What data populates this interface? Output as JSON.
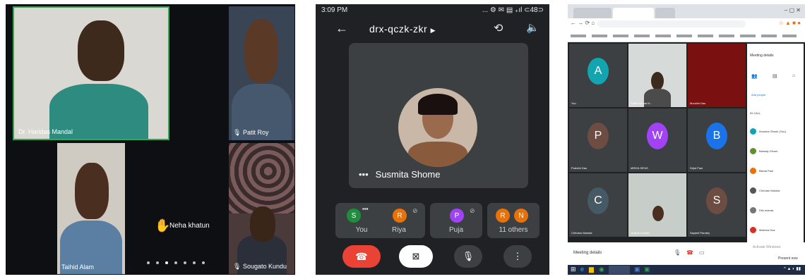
{
  "panel1": {
    "tiles": [
      {
        "name": "Dr. Haridas Mandal"
      },
      {
        "name": "Patit Roy"
      },
      {
        "name": "Taihid Alam"
      },
      {
        "name": "Sougato Kundu"
      }
    ],
    "raised_hand_name": "Neha khatun"
  },
  "panel2": {
    "status_time": "3:09 PM",
    "status_icons": "... ⚙ ✉ ▤ ₊ıl ⊂48⊃",
    "meeting_code": "drx-qczk-zkr",
    "speaker_name": "Susmita Shome",
    "participants": [
      {
        "initial": "S",
        "label": "You",
        "color": "#1e8e3e"
      },
      {
        "initial": "R",
        "label": "Riya",
        "color": "#e8710a"
      },
      {
        "initial": "P",
        "label": "Puja",
        "color": "#a142f4"
      },
      {
        "initial": "R",
        "initial2": "N",
        "label": "11 others",
        "color": "#e8710a",
        "color2": "#e8710a"
      }
    ]
  },
  "panel3": {
    "tiles": [
      {
        "letter": "A",
        "label": "You",
        "color": "#12a4af"
      },
      {
        "letter": "",
        "label": "Pralin Kumar N...",
        "color": "#5c5c5c"
      },
      {
        "letter": "",
        "label": "Mouktin Das",
        "color": "#8a0e0e"
      },
      {
        "letter": "P",
        "label": "Prabehi Das",
        "color": "#6d4c41"
      },
      {
        "letter": "W",
        "label": "MIRZA SIFAS",
        "color": "#a142f4"
      },
      {
        "letter": "B",
        "label": "Srijot Paul",
        "color": "#1a73e8"
      },
      {
        "letter": "C",
        "label": "Chhoton Mandal",
        "color": "#455a64"
      },
      {
        "letter": "",
        "label": "sudipta mahato",
        "color": "#5c5c5c"
      },
      {
        "letter": "S",
        "label": "Sayanti Pandey",
        "color": "#6d4c41"
      }
    ],
    "side_title": "Meeting details",
    "side_people": "Add people",
    "side_section": "IN CALL",
    "side_rows": [
      {
        "name": "Anusina Ghosh (You)",
        "color": "#12a4af"
      },
      {
        "name": "Barsaty Ghosh",
        "color": "#5f8f2f"
      },
      {
        "name": "Bishal Paul",
        "color": "#e8710a"
      },
      {
        "name": "Chhotan Mandal",
        "color": "#555"
      },
      {
        "name": "Dilu manda",
        "color": "#777"
      },
      {
        "name": "Mashira Das",
        "color": "#d93025"
      }
    ],
    "meeting_details_btn": "Meeting details",
    "activate_windows": "Activate Windows",
    "present_now": "Present now"
  }
}
